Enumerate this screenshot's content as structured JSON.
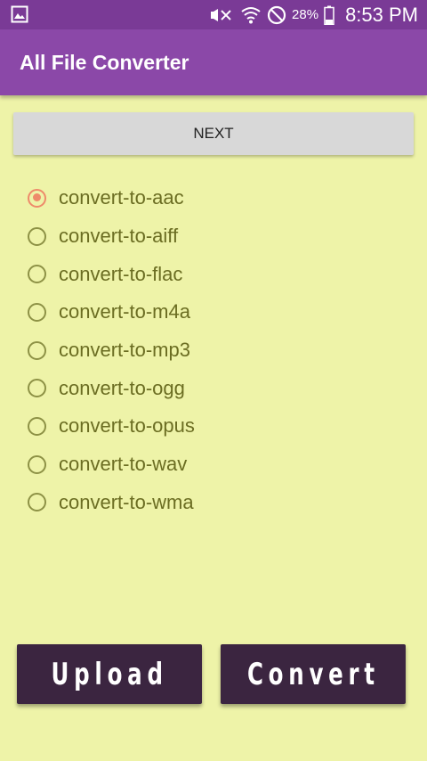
{
  "status_bar": {
    "left_icon": "gallery-icon",
    "icons": [
      "mute-icon",
      "wifi-icon",
      "do-not-disturb-icon"
    ],
    "battery_percent": "28%",
    "time": "8:53 PM"
  },
  "app_bar": {
    "title": "All File Converter"
  },
  "next_button": {
    "label": "NEXT"
  },
  "conversion_options": {
    "selected": "convert-to-aac",
    "items": [
      {
        "label": "convert-to-aac",
        "checked": true
      },
      {
        "label": "convert-to-aiff",
        "checked": false
      },
      {
        "label": "convert-to-flac",
        "checked": false
      },
      {
        "label": "convert-to-m4a",
        "checked": false
      },
      {
        "label": "convert-to-mp3",
        "checked": false
      },
      {
        "label": "convert-to-ogg",
        "checked": false
      },
      {
        "label": "convert-to-opus",
        "checked": false
      },
      {
        "label": "convert-to-wav",
        "checked": false
      },
      {
        "label": "convert-to-wma",
        "checked": false
      }
    ]
  },
  "actions": {
    "upload_label": "Upload",
    "convert_label": "Convert"
  },
  "colors": {
    "status_bar": "#7a3a96",
    "app_bar": "#8b48a8",
    "background": "#eef3a8",
    "radio_checked": "#ee8a6a",
    "radio_unchecked": "#8d9145",
    "option_text": "#6b6d22",
    "action_button": "#3b2540"
  }
}
